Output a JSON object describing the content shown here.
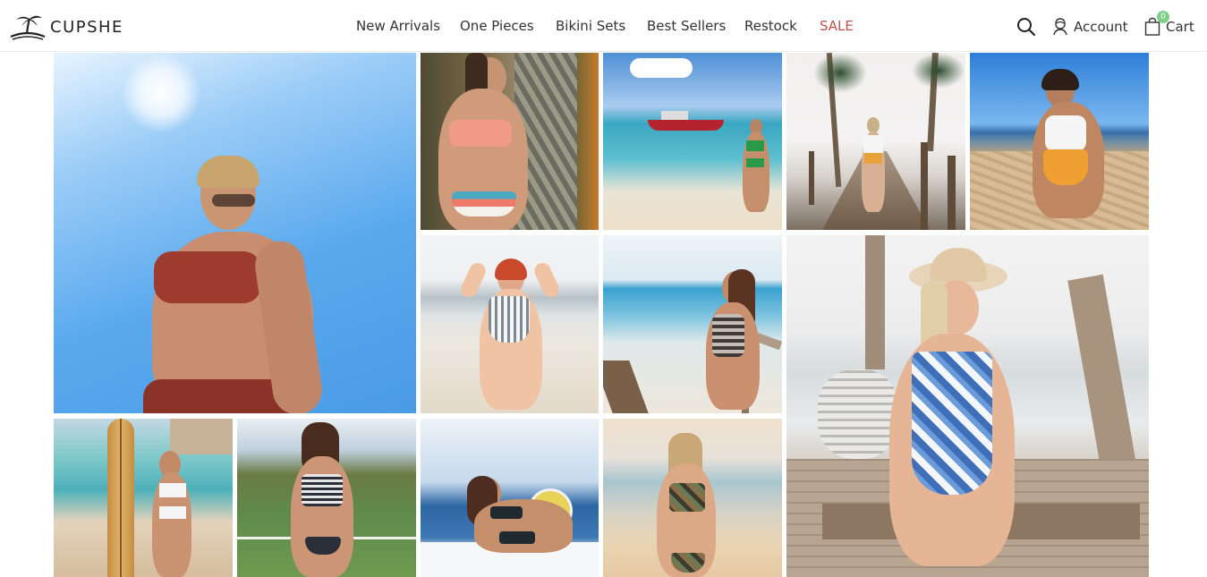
{
  "brand": {
    "name": "CUPSHE",
    "logo_icon": "palm-tree-island-icon"
  },
  "nav": {
    "items": [
      {
        "label": "New Arrivals"
      },
      {
        "label": "One Pieces"
      },
      {
        "label": "Bikini Sets"
      },
      {
        "label": "Best Sellers"
      },
      {
        "label": "Restock"
      },
      {
        "label": "SALE",
        "color": "#c0504f"
      }
    ]
  },
  "tools": {
    "search_icon": "search-icon",
    "account_label": "Account",
    "account_icon": "account-icon",
    "cart_label": "Cart",
    "cart_icon": "shopping-bag-icon",
    "cart_count": "0",
    "badge_color": "#7fcf8a"
  },
  "gallery": {
    "photos": [
      {
        "name": "photo-sky-red-bikini"
      },
      {
        "name": "photo-palm-coral-bikini"
      },
      {
        "name": "photo-beach-boat-green-bikini"
      },
      {
        "name": "photo-boardwalk-palms"
      },
      {
        "name": "photo-kneeling-beach-orange-swimsuit"
      },
      {
        "name": "photo-striped-swimsuit-beach"
      },
      {
        "name": "photo-railing-beach-swimsuit"
      },
      {
        "name": "photo-hat-blue-floral-swimsuit"
      },
      {
        "name": "photo-surfboard-white-bikini"
      },
      {
        "name": "photo-gingham-bikini-greenery"
      },
      {
        "name": "photo-boat-black-bikini"
      },
      {
        "name": "photo-sunset-camo-bikini"
      }
    ]
  }
}
